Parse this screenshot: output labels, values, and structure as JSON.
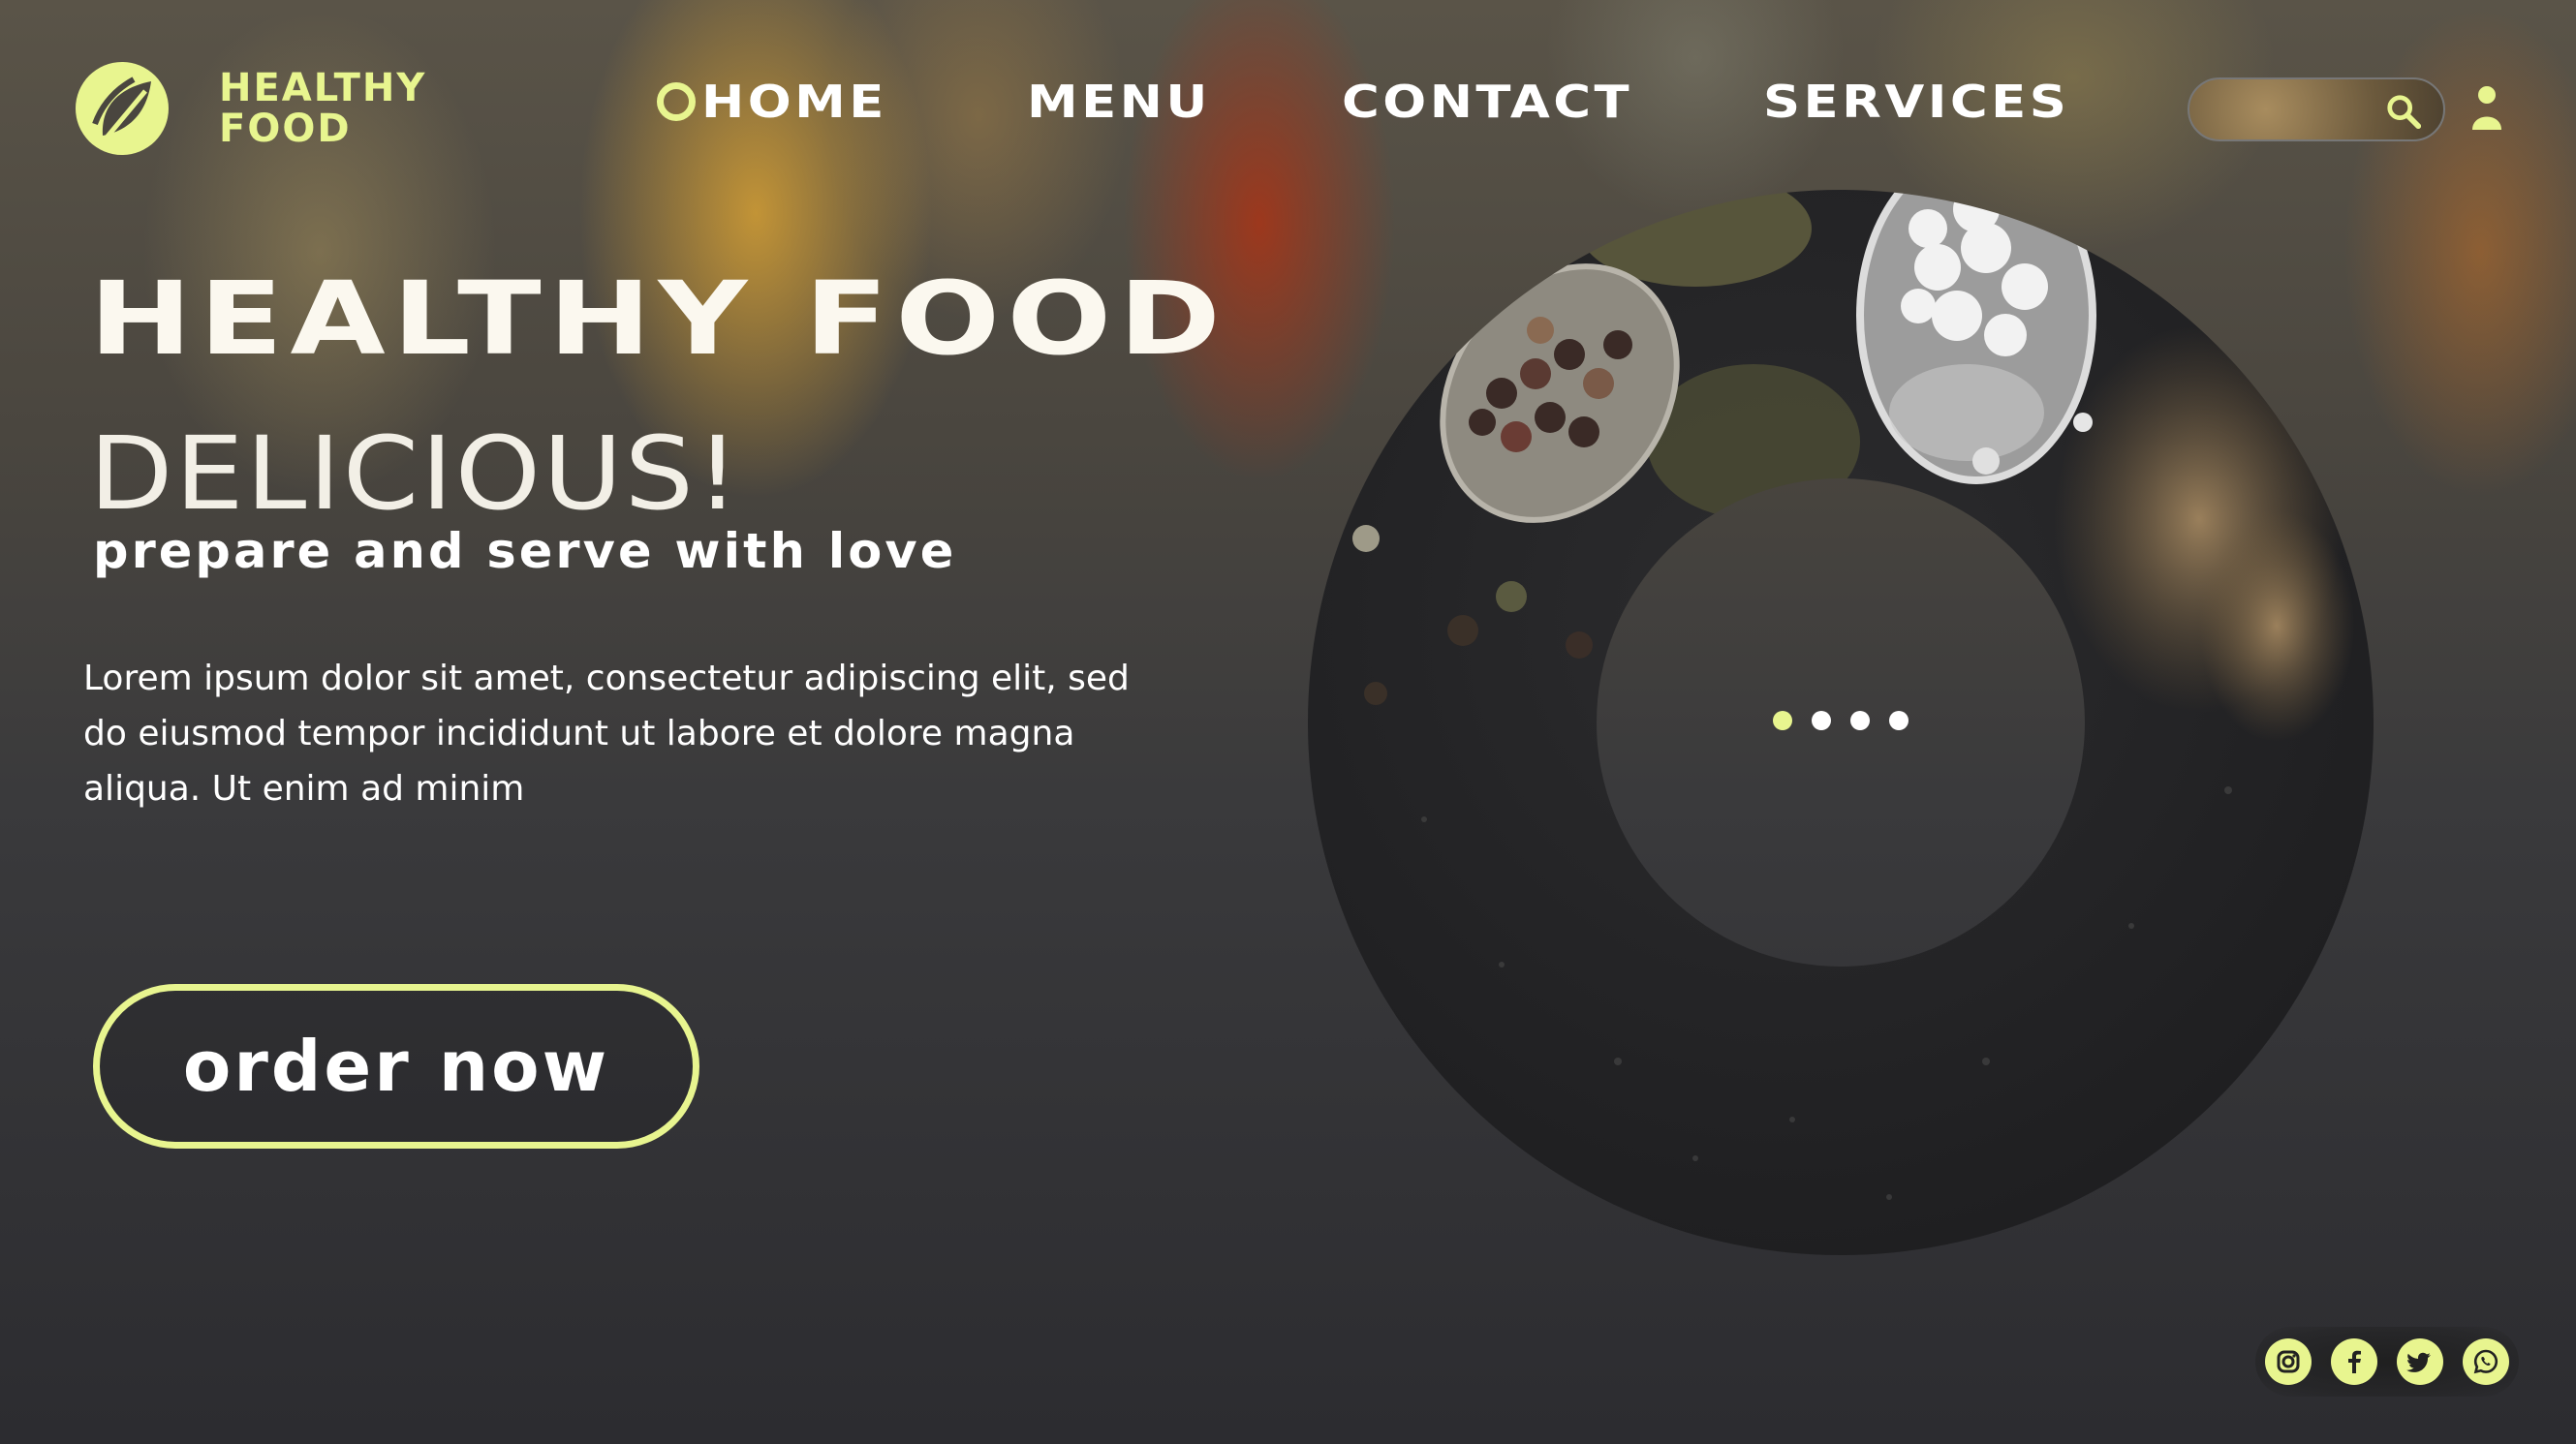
{
  "brand": {
    "line1": "HEALTHY",
    "line2": "FOOD",
    "accent_color": "#e8f58f"
  },
  "nav": {
    "home": "HOME",
    "menu": "MENU",
    "contact": "CONTACT",
    "services": "SERVICES",
    "active": "HOME"
  },
  "search": {
    "placeholder": "",
    "icon": "search-icon"
  },
  "user": {
    "icon": "user-icon"
  },
  "hero": {
    "title": "HEALTHY  FOOD",
    "subtitle": "DELICIOUS!",
    "tagline": "prepare and serve with love",
    "description": "Lorem ipsum dolor sit amet, consectetur adipiscing elit, sed do eiusmod tempor incididunt ut labore et dolore magna aliqua. Ut enim ad minim",
    "cta": "order now"
  },
  "slider": {
    "count": 4,
    "active_index": 0
  },
  "social": [
    {
      "name": "instagram-icon"
    },
    {
      "name": "facebook-icon"
    },
    {
      "name": "twitter-icon"
    },
    {
      "name": "whatsapp-icon"
    }
  ]
}
